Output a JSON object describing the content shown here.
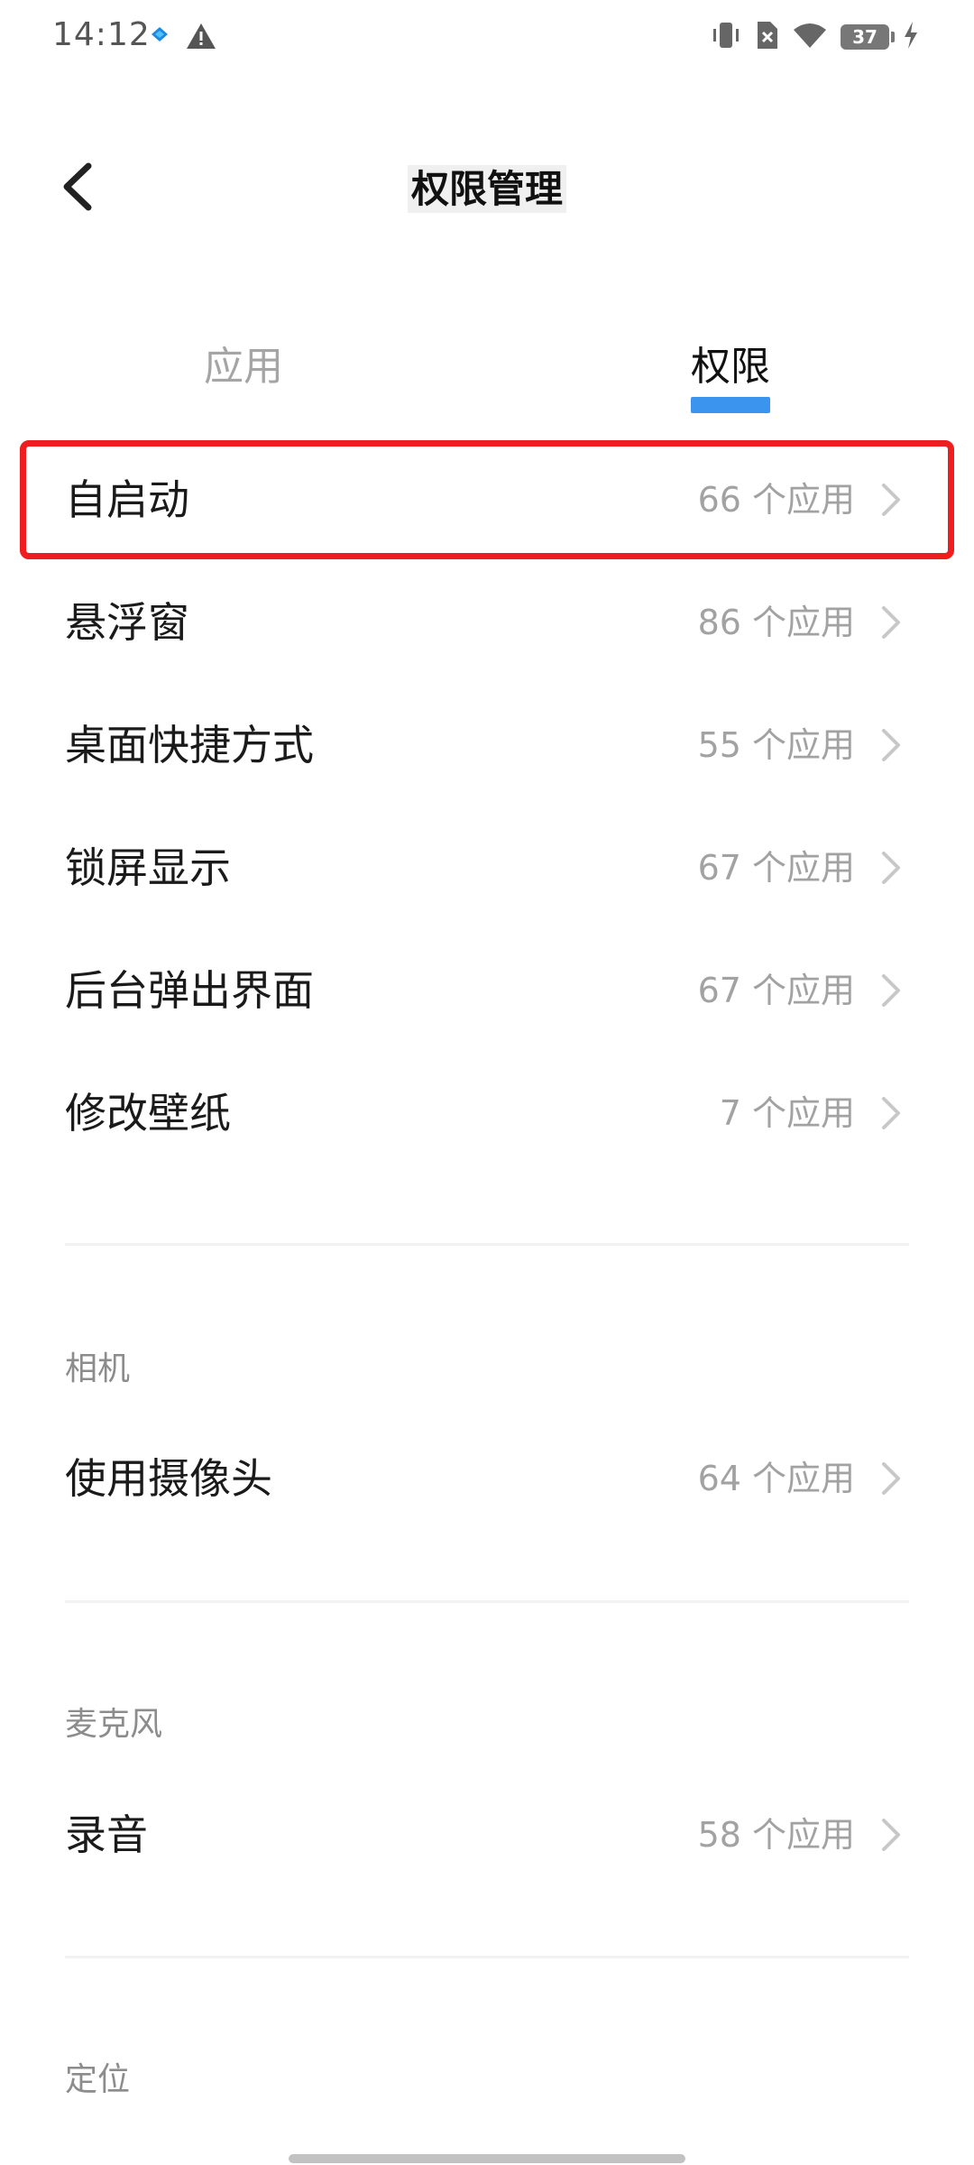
{
  "status_bar": {
    "time": "14:12",
    "battery": "37",
    "icons": [
      "app-notification-icon",
      "warning-icon",
      "vibrate-icon",
      "no-sim-icon",
      "wifi-icon",
      "battery-icon",
      "charging-icon"
    ]
  },
  "header": {
    "back_icon": "chevron-left-icon",
    "title": "权限管理"
  },
  "tabs": [
    {
      "label": "应用",
      "active": false
    },
    {
      "label": "权限",
      "active": true
    }
  ],
  "accent_color": "#3b95ef",
  "highlight_color": "#ef1d1d",
  "permissions_main": [
    {
      "label": "自启动",
      "count": "66 个应用",
      "highlighted": true
    },
    {
      "label": "悬浮窗",
      "count": "86 个应用"
    },
    {
      "label": "桌面快捷方式",
      "count": "55 个应用"
    },
    {
      "label": "锁屏显示",
      "count": "67 个应用"
    },
    {
      "label": "后台弹出界面",
      "count": "67 个应用"
    },
    {
      "label": "修改壁纸",
      "count": "7 个应用"
    }
  ],
  "sections": [
    {
      "title": "相机",
      "items": [
        {
          "label": "使用摄像头",
          "count": "64 个应用"
        }
      ]
    },
    {
      "title": "麦克风",
      "items": [
        {
          "label": "录音",
          "count": "58 个应用"
        }
      ]
    },
    {
      "title": "定位",
      "items": []
    }
  ]
}
